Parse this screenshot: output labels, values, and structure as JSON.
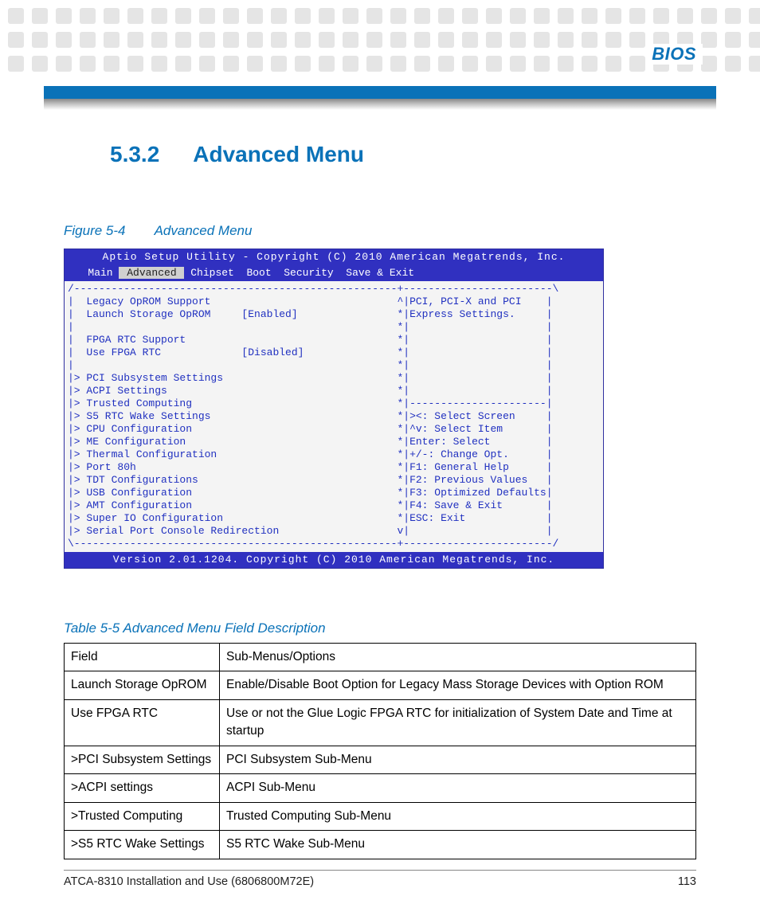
{
  "header": {
    "label": "BIOS"
  },
  "section": {
    "number": "5.3.2",
    "title": "Advanced Menu"
  },
  "figure": {
    "label": "Figure 5-4",
    "title": "Advanced Menu"
  },
  "bios": {
    "title_top": "Aptio Setup Utility - Copyright (C) 2010 American Megatrends, Inc.",
    "menubar_pre": "   Main ",
    "menubar_sel": " Advanced ",
    "menubar_post": " Chipset  Boot  Security  Save & Exit",
    "body": "/----------------------------------------------------+------------------------\\\n|  Legacy OpROM Support                              ^|PCI, PCI-X and PCI    |\n|  Launch Storage OpROM     [Enabled]                *|Express Settings.     |\n|                                                    *|                      |\n|  FPGA RTC Support                                  *|                      |\n|  Use FPGA RTC             [Disabled]               *|                      |\n|                                                    *|                      |\n|> PCI Subsystem Settings                            *|                      |\n|> ACPI Settings                                     *|                      |\n|> Trusted Computing                                 *|----------------------|\n|> S5 RTC Wake Settings                              *|><: Select Screen     |\n|> CPU Configuration                                 *|^v: Select Item       |\n|> ME Configuration                                  *|Enter: Select         |\n|> Thermal Configuration                             *|+/-: Change Opt.      |\n|> Port 80h                                          *|F1: General Help      |\n|> TDT Configurations                                *|F2: Previous Values   |\n|> USB Configuration                                 *|F3: Optimized Defaults|\n|> AMT Configuration                                 *|F4: Save & Exit       |\n|> Super IO Configuration                            *|ESC: Exit             |\n|> Serial Port Console Redirection                   v|                      |\n\\----------------------------------------------------+------------------------/",
    "footer": "Version 2.01.1204. Copyright (C) 2010 American Megatrends, Inc."
  },
  "table": {
    "caption": "Table 5-5 Advanced Menu Field Description",
    "rows": [
      {
        "field": "Field",
        "desc": "Sub-Menus/Options"
      },
      {
        "field": "Launch Storage OpROM",
        "desc": "Enable/Disable Boot Option for Legacy Mass Storage Devices with Option ROM"
      },
      {
        "field": "Use FPGA RTC",
        "desc": "Use or not the Glue Logic FPGA RTC for initialization of System Date and Time at startup"
      },
      {
        "field": ">PCI Subsystem Settings",
        "desc": "PCI Subsystem Sub-Menu"
      },
      {
        "field": ">ACPI settings",
        "desc": "ACPI Sub-Menu"
      },
      {
        "field": ">Trusted Computing",
        "desc": "Trusted Computing Sub-Menu"
      },
      {
        "field": ">S5 RTC Wake Settings",
        "desc": "S5 RTC Wake Sub-Menu"
      }
    ]
  },
  "footer": {
    "doc": "ATCA-8310 Installation and Use (6806800M72E)",
    "page": "113"
  }
}
